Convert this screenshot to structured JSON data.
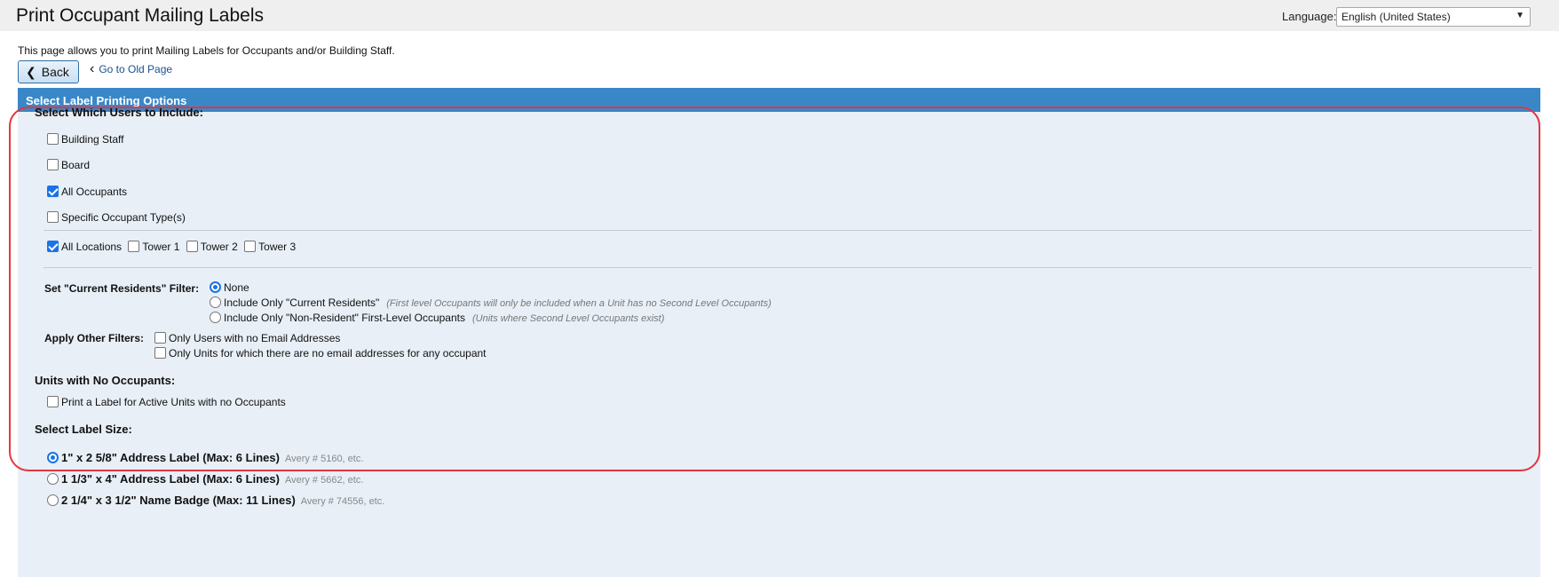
{
  "header": {
    "title": "Print Occupant Mailing Labels",
    "language_label": "Language:",
    "language_value": "English (United States)"
  },
  "intro": "This page allows you to print Mailing Labels for Occupants and/or Building Staff.",
  "nav": {
    "back_label": "Back",
    "old_page_label": "Go to Old Page"
  },
  "panel": {
    "title": "Select Label Printing Options",
    "users_heading": "Select Which Users to Include:",
    "users": [
      {
        "label": "Building Staff",
        "checked": false
      },
      {
        "label": "Board",
        "checked": false
      },
      {
        "label": "All Occupants",
        "checked": true
      },
      {
        "label": "Specific Occupant Type(s)",
        "checked": false
      }
    ],
    "locations": [
      {
        "label": "All Locations",
        "checked": true
      },
      {
        "label": "Tower 1",
        "checked": false
      },
      {
        "label": "Tower 2",
        "checked": false
      },
      {
        "label": "Tower 3",
        "checked": false
      }
    ],
    "residents_filter": {
      "label": "Set \"Current Residents\" Filter:",
      "options": [
        {
          "label": "None",
          "note": "",
          "selected": true
        },
        {
          "label": "Include Only \"Current Residents\"",
          "note": "(First level Occupants will only be included when a Unit has no Second Level Occupants)",
          "selected": false
        },
        {
          "label": "Include Only \"Non-Resident\" First-Level Occupants",
          "note": "(Units where Second Level Occupants exist)",
          "selected": false
        }
      ]
    },
    "other_filters": {
      "label": "Apply Other Filters:",
      "options": [
        {
          "label": "Only Users with no Email Addresses",
          "checked": false
        },
        {
          "label": "Only Units for which there are no email addresses for any occupant",
          "checked": false
        }
      ]
    },
    "no_occupants": {
      "heading": "Units with No Occupants:",
      "option": "Print a Label for Active Units with no Occupants",
      "checked": false
    },
    "label_size": {
      "heading": "Select Label Size:",
      "options": [
        {
          "label": "1\" x 2 5/8\" Address Label (Max: 6 Lines)",
          "avery": "Avery # 5160, etc.",
          "selected": true
        },
        {
          "label": "1 1/3\" x 4\" Address Label (Max: 6 Lines)",
          "avery": "Avery # 5662, etc.",
          "selected": false
        },
        {
          "label": "2 1/4\" x 3 1/2\" Name Badge (Max: 11 Lines)",
          "avery": "Avery # 74556, etc.",
          "selected": false
        }
      ]
    }
  },
  "colors": {
    "header_bar": "#3a87c8",
    "panel_bg": "#e8eff7",
    "highlight": "#e4363e",
    "checkbox_accent": "#1a73e8"
  }
}
